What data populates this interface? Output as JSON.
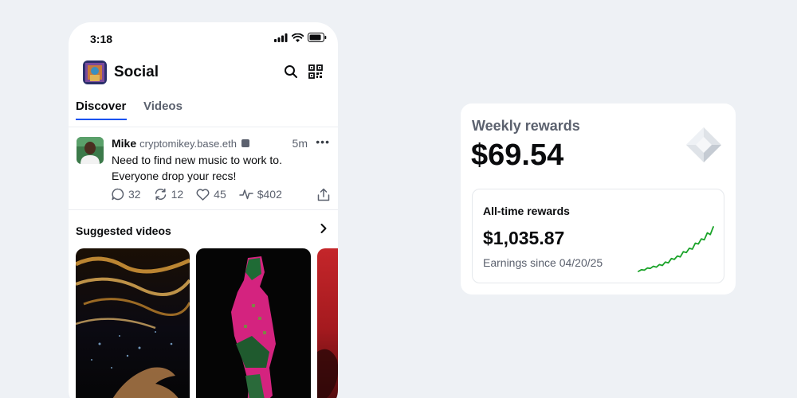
{
  "status_bar": {
    "time": "3:18"
  },
  "app": {
    "title": "Social"
  },
  "tabs": [
    {
      "label": "Discover",
      "active": true
    },
    {
      "label": "Videos",
      "active": false
    }
  ],
  "post": {
    "author_name": "Mike",
    "author_handle": "cryptomikey.base.eth",
    "time": "5m",
    "text": "Need to find new music to work to. Everyone drop your recs!",
    "replies": "32",
    "recasts": "12",
    "likes": "45",
    "tips": "$402"
  },
  "suggested": {
    "title": "Suggested videos"
  },
  "rewards": {
    "weekly_label": "Weekly rewards",
    "weekly_amount": "$69.54",
    "alltime_label": "All-time rewards",
    "alltime_amount": "$1,035.87",
    "since_text": "Earnings since 04/20/25",
    "sparkline": [
      0,
      2,
      1.5,
      4,
      3.5,
      6,
      5,
      8,
      7,
      11,
      10,
      15,
      14,
      18,
      17,
      23,
      22,
      27,
      26,
      33,
      32,
      38,
      37,
      45,
      43,
      52
    ],
    "sparkline_color": "#1aa329"
  },
  "colors": {
    "accent": "#1652f0",
    "background": "#eef1f5"
  }
}
